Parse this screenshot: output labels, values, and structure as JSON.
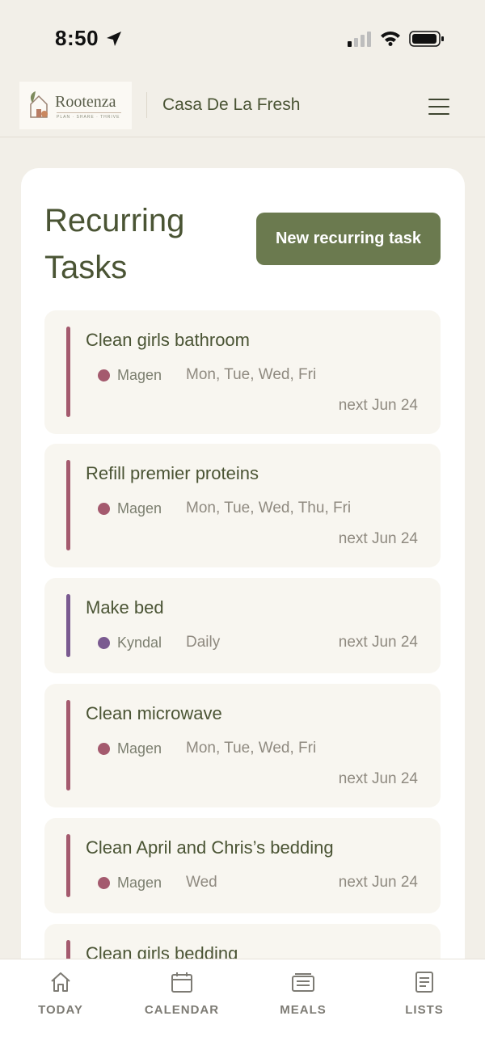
{
  "status_bar": {
    "time": "8:50"
  },
  "header": {
    "logo_text": "Rootenza",
    "logo_tagline": "PLAN · SHARE · THRIVE",
    "household_name": "Casa De La Fresh"
  },
  "page": {
    "title": "Recurring Tasks",
    "new_task_label": "New recurring task"
  },
  "tasks": [
    {
      "title": "Clean girls bathroom",
      "assignee": "Magen",
      "schedule": "Mon, Tue, Wed, Fri",
      "next": "next Jun 24",
      "color": "#a45a6e"
    },
    {
      "title": "Refill premier proteins",
      "assignee": "Magen",
      "schedule": "Mon, Tue, Wed, Thu, Fri",
      "next": "next Jun 24",
      "color": "#a45a6e"
    },
    {
      "title": "Make bed",
      "assignee": "Kyndal",
      "schedule": "Daily",
      "next": "next Jun 24",
      "color": "#7a5a90"
    },
    {
      "title": "Clean microwave",
      "assignee": "Magen",
      "schedule": "Mon, Tue, Wed, Fri",
      "next": "next Jun 24",
      "color": "#a45a6e"
    },
    {
      "title": "Clean April and Chris’s bedding",
      "assignee": "Magen",
      "schedule": "Wed",
      "next": "next Jun 24",
      "color": "#a45a6e"
    },
    {
      "title": "Clean girls bedding",
      "color": "#a45a6e"
    }
  ],
  "bottom_nav": [
    {
      "label": "TODAY",
      "icon": "home-icon"
    },
    {
      "label": "CALENDAR",
      "icon": "calendar-icon"
    },
    {
      "label": "MEALS",
      "icon": "meals-icon"
    },
    {
      "label": "LISTS",
      "icon": "lists-icon"
    }
  ]
}
